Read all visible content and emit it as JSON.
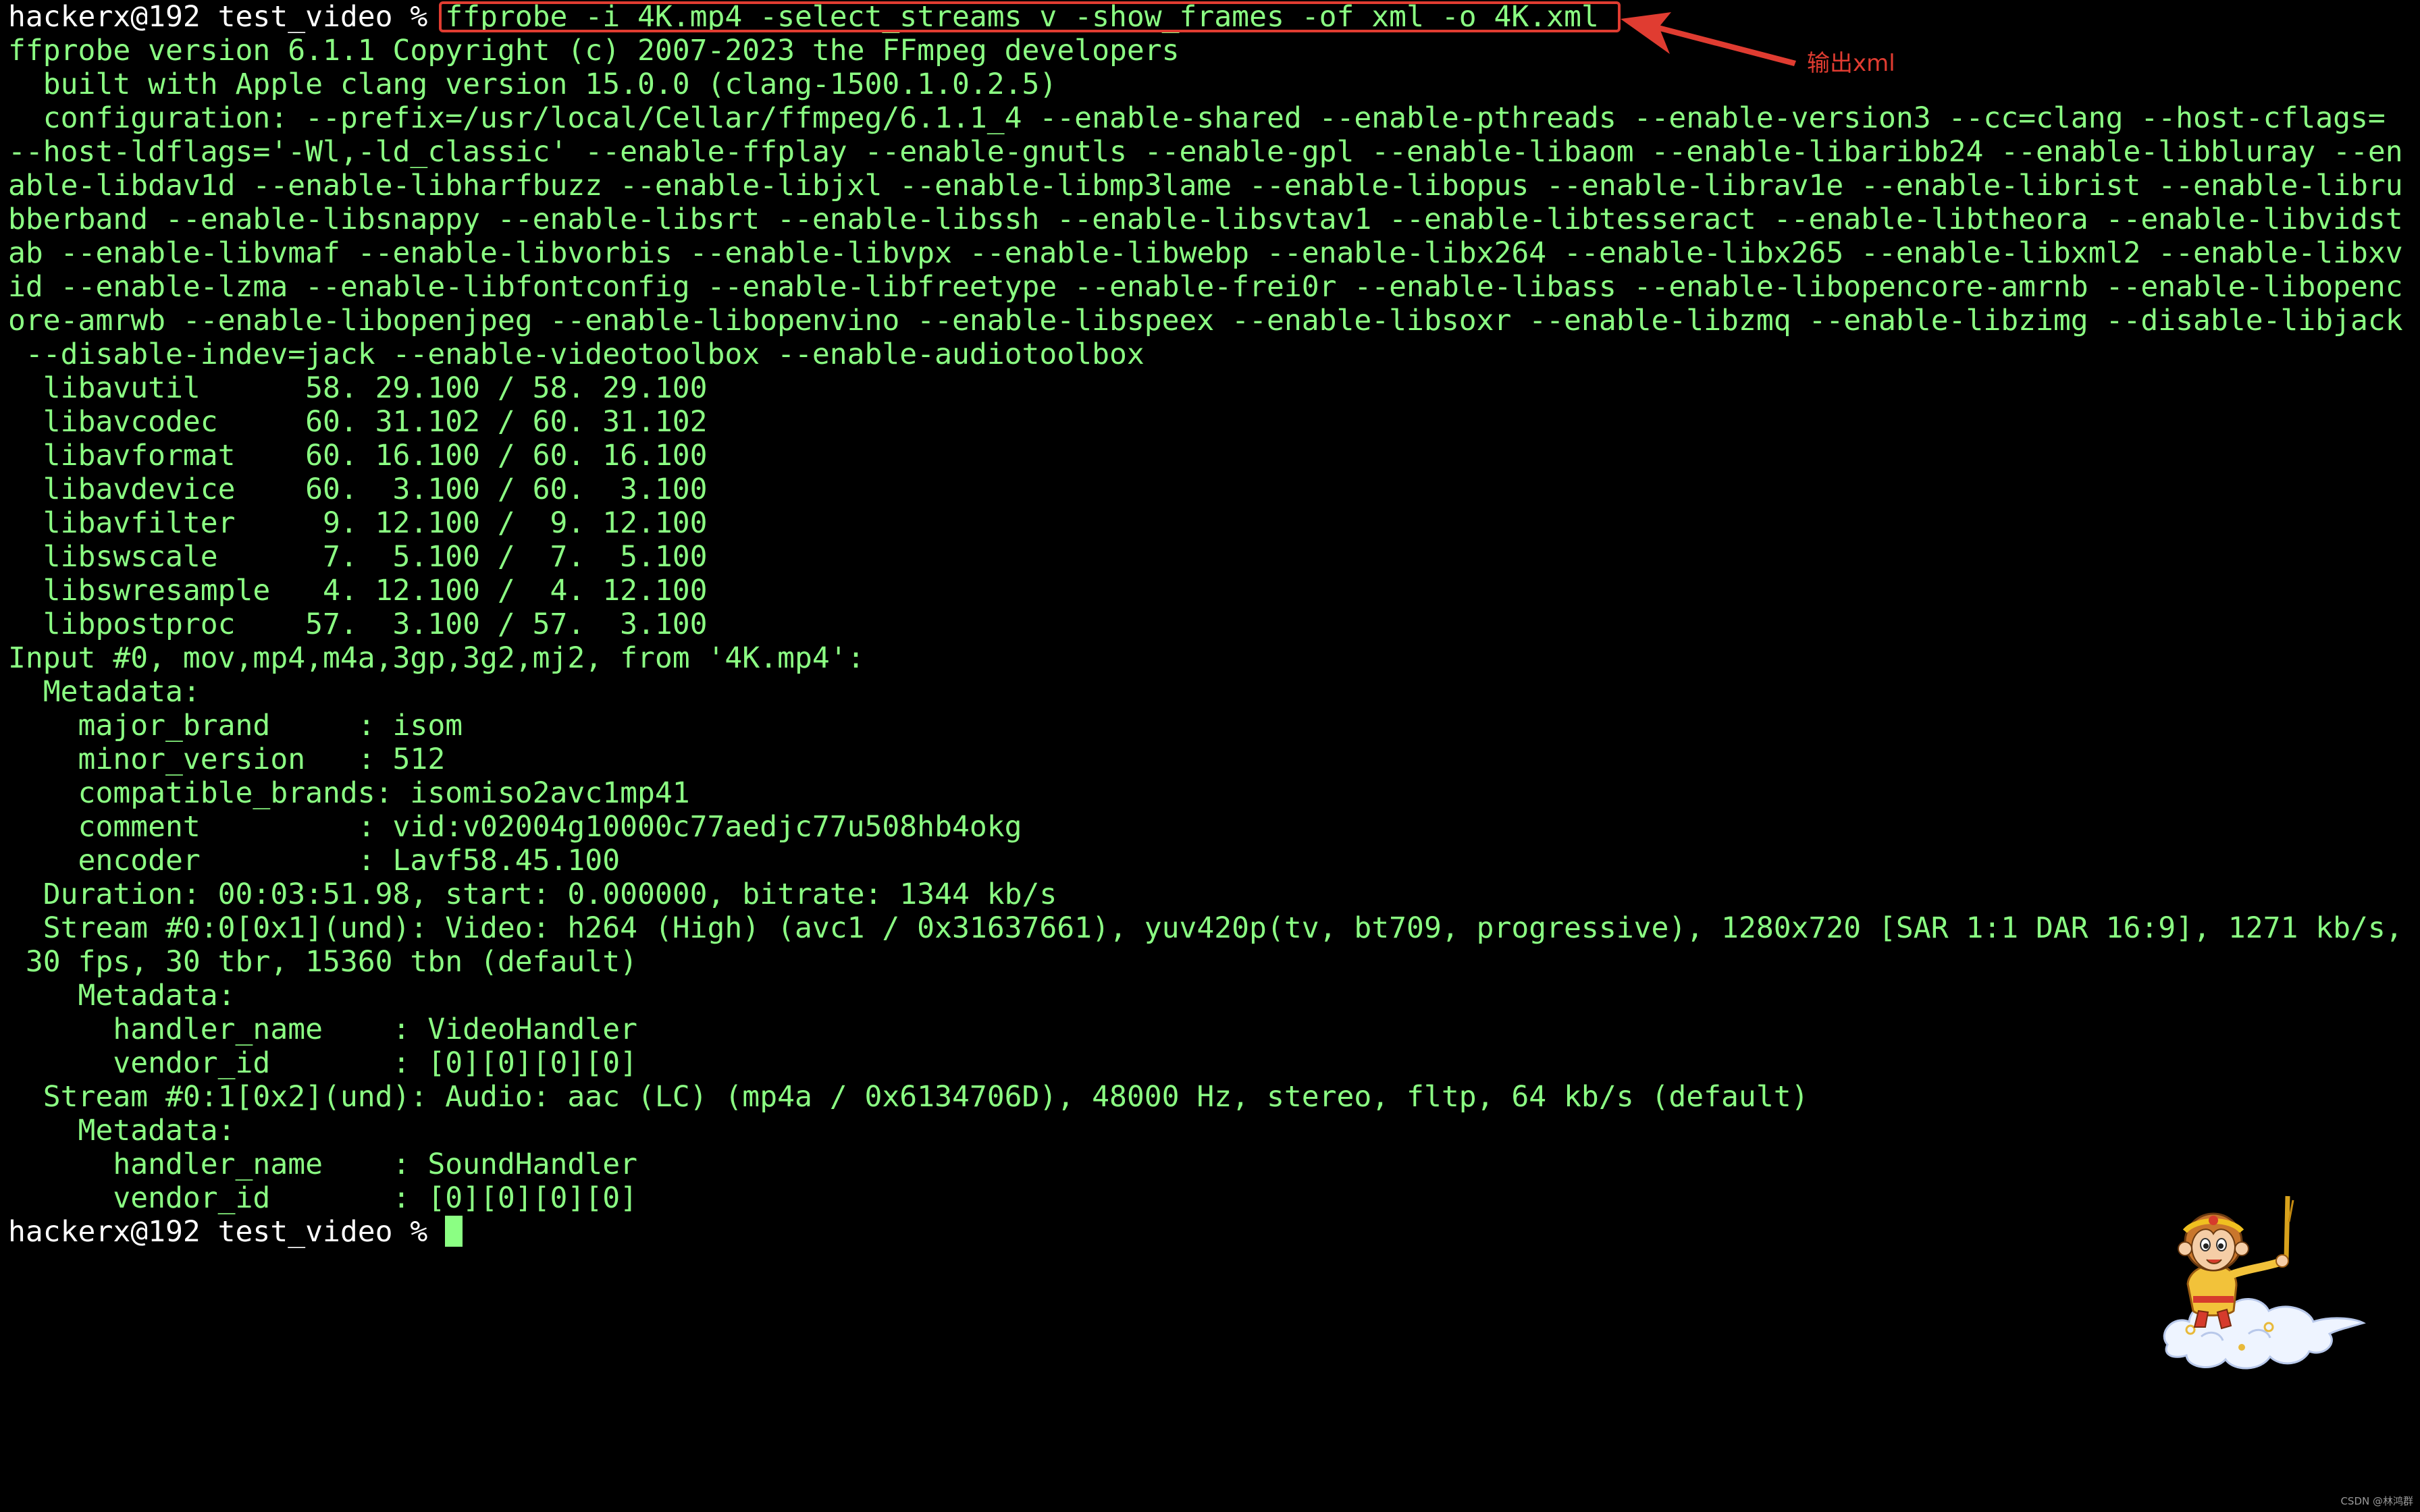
{
  "terminal": {
    "prompt": "hackerx@192 test_video % ",
    "command": "ffprobe -i 4K.mp4 -select_streams v -show_frames -of xml -o 4K.xml",
    "output": [
      "ffprobe version 6.1.1 Copyright (c) 2007-2023 the FFmpeg developers",
      "  built with Apple clang version 15.0.0 (clang-1500.1.0.2.5)",
      "  configuration: --prefix=/usr/local/Cellar/ffmpeg/6.1.1_4 --enable-shared --enable-pthreads --enable-version3 --cc=clang --host-cflags=",
      "--host-ldflags='-Wl,-ld_classic' --enable-ffplay --enable-gnutls --enable-gpl --enable-libaom --enable-libaribb24 --enable-libbluray --en",
      "able-libdav1d --enable-libharfbuzz --enable-libjxl --enable-libmp3lame --enable-libopus --enable-librav1e --enable-librist --enable-libru",
      "bberband --enable-libsnappy --enable-libsrt --enable-libssh --enable-libsvtav1 --enable-libtesseract --enable-libtheora --enable-libvidst",
      "ab --enable-libvmaf --enable-libvorbis --enable-libvpx --enable-libwebp --enable-libx264 --enable-libx265 --enable-libxml2 --enable-libxv",
      "id --enable-lzma --enable-libfontconfig --enable-libfreetype --enable-frei0r --enable-libass --enable-libopencore-amrnb --enable-libopenc",
      "ore-amrwb --enable-libopenjpeg --enable-libopenvino --enable-libspeex --enable-libsoxr --enable-libzmq --enable-libzimg --disable-libjack",
      " --disable-indev=jack --enable-videotoolbox --enable-audiotoolbox",
      "  libavutil      58. 29.100 / 58. 29.100",
      "  libavcodec     60. 31.102 / 60. 31.102",
      "  libavformat    60. 16.100 / 60. 16.100",
      "  libavdevice    60.  3.100 / 60.  3.100",
      "  libavfilter     9. 12.100 /  9. 12.100",
      "  libswscale      7.  5.100 /  7.  5.100",
      "  libswresample   4. 12.100 /  4. 12.100",
      "  libpostproc    57.  3.100 / 57.  3.100",
      "Input #0, mov,mp4,m4a,3gp,3g2,mj2, from '4K.mp4':",
      "  Metadata:",
      "    major_brand     : isom",
      "    minor_version   : 512",
      "    compatible_brands: isomiso2avc1mp41",
      "    comment         : vid:v02004g10000c77aedjc77u508hb4okg",
      "    encoder         : Lavf58.45.100",
      "  Duration: 00:03:51.98, start: 0.000000, bitrate: 1344 kb/s",
      "  Stream #0:0[0x1](und): Video: h264 (High) (avc1 / 0x31637661), yuv420p(tv, bt709, progressive), 1280x720 [SAR 1:1 DAR 16:9], 1271 kb/s,",
      " 30 fps, 30 tbr, 15360 tbn (default)",
      "    Metadata:",
      "      handler_name    : VideoHandler",
      "      vendor_id       : [0][0][0][0]",
      "  Stream #0:1[0x2](und): Audio: aac (LC) (mp4a / 0x6134706D), 48000 Hz, stereo, fltp, 64 kb/s (default)",
      "    Metadata:",
      "      handler_name    : SoundHandler",
      "      vendor_id       : [0][0][0][0]"
    ],
    "final_prompt": "hackerx@192 test_video % "
  },
  "annotation": {
    "label": "输出xml",
    "color": "#e03c31"
  },
  "colors": {
    "background": "#000000",
    "text_green": "#8bff83",
    "prompt_white": "#ffffff"
  },
  "watermark": "CSDN @林鸿群",
  "icons": {
    "sticker": "monkey-king-on-cloud-sticker",
    "arrow": "annotation-arrow-icon"
  }
}
